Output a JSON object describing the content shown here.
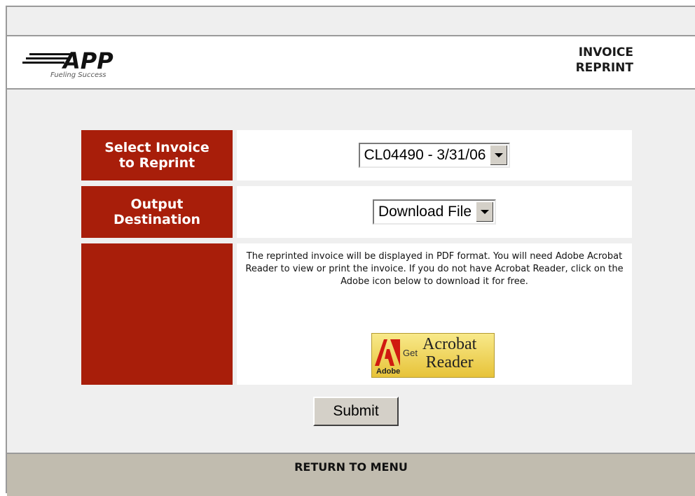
{
  "header": {
    "logo_text": "APP",
    "logo_tagline": "Fueling Success",
    "title": "INVOICE\nREPRINT"
  },
  "form": {
    "invoice": {
      "label": "Select Invoice\nto Reprint",
      "selected": "CL04490 - 3/31/06"
    },
    "output": {
      "label": "Output\nDestination",
      "selected": "Download File"
    },
    "info_text": "The reprinted invoice will be displayed in PDF format. You will need Adobe Acrobat Reader to view or print the invoice. If you do not have Acrobat Reader, click on the Adobe icon below to download it for free.",
    "adobe_badge": {
      "brand": "Adobe",
      "get": "Get",
      "product": "Acrobat\nReader"
    },
    "submit_label": "Submit"
  },
  "footer": {
    "return_label": "RETURN TO MENU"
  },
  "colors": {
    "label_bg": "#a81e0a",
    "panel_bg": "#efefef",
    "footer_bg": "#c1bcaf"
  }
}
